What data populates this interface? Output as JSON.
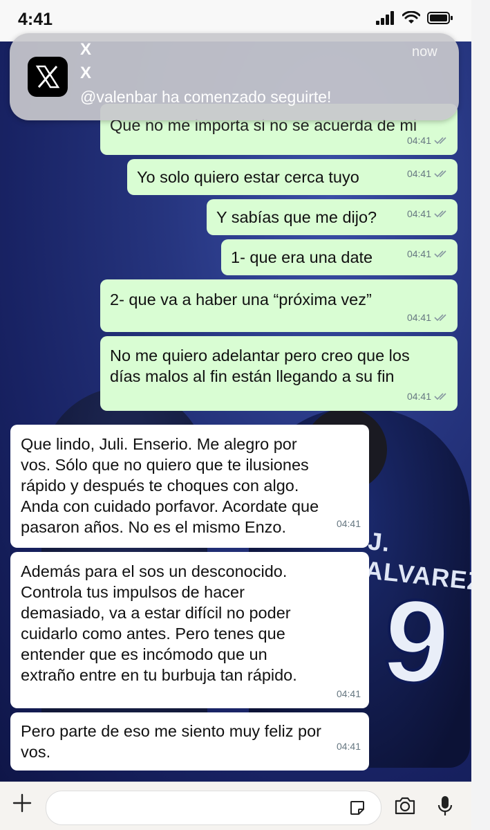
{
  "status_bar": {
    "time": "4:41"
  },
  "notification": {
    "app_name": "X",
    "title": "X",
    "body": "@valenbar ha comenzado seguirte!",
    "time": "now"
  },
  "messages": [
    {
      "dir": "out",
      "text": "Que no me importa si no se acuerda de mi",
      "time": "04:41"
    },
    {
      "dir": "out",
      "text": "Yo solo quiero estar cerca tuyo",
      "time": "04:41"
    },
    {
      "dir": "out",
      "text": "Y sabías que me dijo?",
      "time": "04:41"
    },
    {
      "dir": "out",
      "text": "1- que era una date",
      "time": "04:41"
    },
    {
      "dir": "out",
      "text": "2- que va a haber una “próxima vez”",
      "time": "04:41"
    },
    {
      "dir": "out",
      "lines": [
        "No me quiero adelantar pero creo que los",
        "días malos al fin están llegando a su fin"
      ],
      "time": "04:41"
    },
    {
      "dir": "in",
      "lines": [
        "Que lindo, Juli. Enserio. Me alegro por",
        "vos. Sólo que no quiero que te ilusiones",
        "rápido y después te choques con algo.",
        "Anda con cuidado porfavor. Acordate que",
        "pasaron años. No es el mismo Enzo."
      ],
      "time": "04:41"
    },
    {
      "dir": "in",
      "lines": [
        "Además para el sos un desconocido.",
        "Controla tus impulsos de hacer",
        "demasiado, va a estar difícil no poder",
        "cuidarlo como antes. Pero tenes que",
        "entender que es incómodo que un",
        "extraño entre en tu burbuja tan rápido."
      ],
      "time": "04:41"
    },
    {
      "dir": "in",
      "lines": [
        "Pero parte de eso me siento muy feliz por",
        "vos."
      ],
      "time": "04:41"
    }
  ],
  "background": {
    "jersey_name": "J. ALVAREZ",
    "jersey_number": "9"
  },
  "icons": {
    "notif": "x-logo-icon",
    "signal": "signal-icon",
    "wifi": "wifi-icon",
    "battery": "battery-icon",
    "plus": "plus-icon",
    "sticker": "sticker-icon",
    "camera": "camera-icon",
    "mic": "microphone-icon",
    "read": "double-check-icon"
  },
  "colors": {
    "outgoing_bubble": "#d9fdd3",
    "incoming_bubble": "#ffffff",
    "read_ticks": "#8696a0"
  }
}
